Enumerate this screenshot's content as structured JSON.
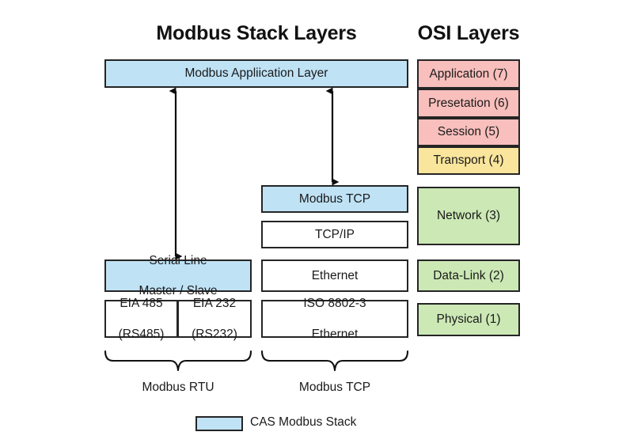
{
  "headings": {
    "modbus_stack": "Modbus Stack Layers",
    "osi": "OSI Layers"
  },
  "modbus_stack": {
    "application_layer": "Modbus Appliication Layer",
    "tcp_column": [
      {
        "name": "modbus-tcp",
        "label": "Modbus TCP",
        "color": "#bfe2f5"
      },
      {
        "name": "tcp-ip",
        "label": "TCP/IP",
        "color": "#ffffff"
      },
      {
        "name": "ethernet",
        "label": "Ethernet",
        "color": "#ffffff"
      },
      {
        "name": "iso-8802-3",
        "label_line1": "ISO 8802-3",
        "label_line2": "Ethernet",
        "color": "#ffffff"
      }
    ],
    "serial_column": [
      {
        "name": "serial-line",
        "label_line1": "Serial Line",
        "label_line2": "Master / Slave",
        "color": "#bfe2f5"
      },
      {
        "name": "eia-485",
        "label_line1": "EIA 485",
        "label_line2": "(RS485)",
        "color": "#ffffff"
      },
      {
        "name": "eia-232",
        "label_line1": "EIA 232",
        "label_line2": "(RS232)",
        "color": "#ffffff"
      }
    ]
  },
  "osi_layers": [
    {
      "name": "application",
      "label": "Application (7)",
      "color": "#f8bfbc"
    },
    {
      "name": "presetation",
      "label": "Presetation (6)",
      "color": "#f8bfbc"
    },
    {
      "name": "session",
      "label": "Session (5)",
      "color": "#f8bfbc"
    },
    {
      "name": "transport",
      "label": "Transport (4)",
      "color": "#fae59c"
    },
    {
      "name": "network",
      "label": "Network (3)",
      "color": "#cce8b5"
    },
    {
      "name": "data-link",
      "label": "Data-Link (2)",
      "color": "#cce8b5"
    },
    {
      "name": "physical",
      "label": "Physical (1)",
      "color": "#cce8b5"
    }
  ],
  "braces": {
    "left_label": "Modbus RTU",
    "right_label": "Modbus TCP"
  },
  "legend": {
    "label": "CAS Modbus Stack",
    "swatch_color": "#bfe2f5"
  },
  "colors": {
    "blue": "#bfe2f5",
    "pink": "#f8bfbc",
    "yellow": "#fae59c",
    "green": "#cce8b5",
    "stroke": "#252525",
    "background": "#ffffff"
  }
}
